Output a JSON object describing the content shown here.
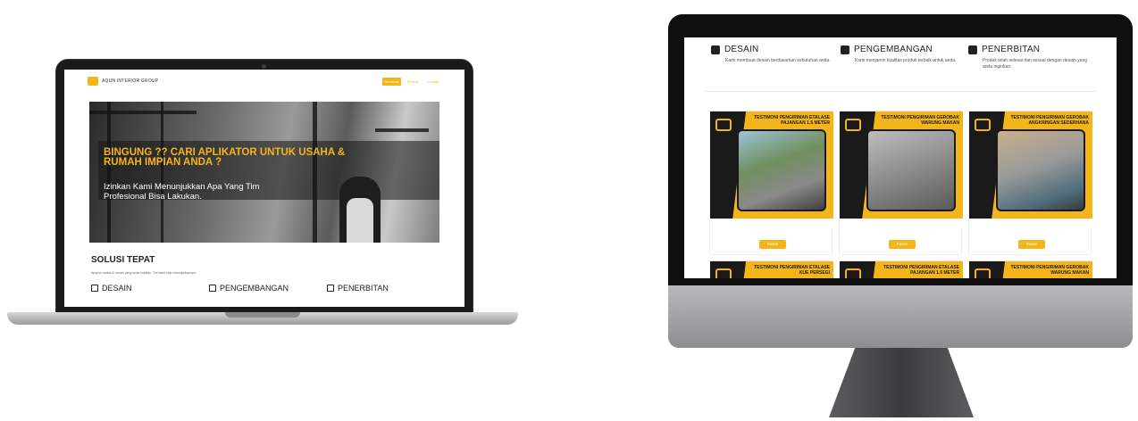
{
  "laptop": {
    "brand": "AQUN INTERIOR GROUP",
    "nav": [
      "Beranda",
      "Produk",
      "Kontak"
    ],
    "hero": {
      "headline": "BINGUNG ?? CARI APLIKATOR UNTUK USAHA & RUMAH IMPIAN ANDA ?",
      "subheadline": "Izinkan Kami Menunjukkan Apa Yang Tim Profesional Bisa Lakukan."
    },
    "section": {
      "title": "SOLUSI TEPAT",
      "text": "Apapun usaha & rumah yang anda impikan. Tim kami siap mewujudkannya."
    },
    "features": [
      "DESAIN",
      "PENGEMBANGAN",
      "PENERBITAN"
    ]
  },
  "monitor": {
    "features": [
      {
        "title": "DESAIN",
        "desc": "Kami membuat desain berdasarkan kebutuhan anda.",
        "icon": "edit-icon"
      },
      {
        "title": "PENGEMBANGAN",
        "desc": "Kami menjamin kualitas produk terbaik untuk anda.",
        "icon": "map-icon"
      },
      {
        "title": "PENERBITAN",
        "desc": "Produk telah selesai dan sesuai dengan desain yang anda inginkan.",
        "icon": "truck-icon"
      }
    ],
    "cards": [
      {
        "poster_title": "TESTIMONI PENGIRIMAN ETALASE PAJANGAN 1.5 METER",
        "button": "Pesan"
      },
      {
        "poster_title": "TESTIMONI PENGIRIMAN GEROBAK WARUNG MAKAN",
        "button": "Pesan"
      },
      {
        "poster_title": "TESTIMONI PENGIRIMAN GEROBAK ANGKRINGAN SEDERHANA",
        "button": "Pesan"
      },
      {
        "poster_title": "TESTIMONI PENGIRIMAN ETALASE KUE PERSEGI",
        "button": ""
      },
      {
        "poster_title": "TESTIMONI PENGIRIMAN ETALASE PAJANGAN 1.5 METER",
        "button": ""
      },
      {
        "poster_title": "TESTIMONI PENGIRIMAN GEROBAK WARUNG MAKAN",
        "button": ""
      }
    ]
  },
  "colors": {
    "accent": "#f4b51b",
    "dark": "#1a1a1a"
  }
}
